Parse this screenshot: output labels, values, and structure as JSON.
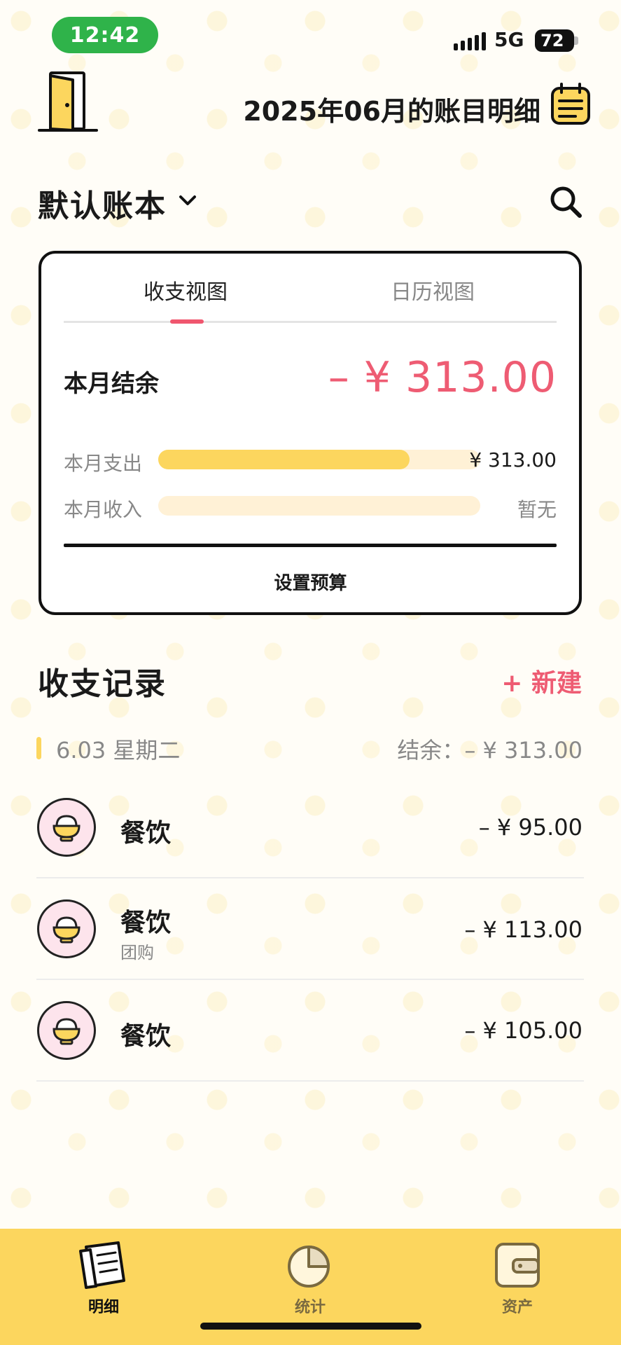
{
  "status_bar": {
    "time": "12:42",
    "network": "5G",
    "battery": "72"
  },
  "header": {
    "title": "2025年06月的账目明细"
  },
  "book_selector": {
    "label": "默认账本"
  },
  "summary_card": {
    "tabs": [
      {
        "label": "收支视图",
        "active": true
      },
      {
        "label": "日历视图",
        "active": false
      }
    ],
    "balance_label": "本月结余",
    "balance_amount": "– ¥ 313.00",
    "expense": {
      "label": "本月支出",
      "value": "¥ 313.00",
      "fill": 0.78
    },
    "income": {
      "label": "本月收入",
      "value": "暂无",
      "fill": 0
    },
    "budget_button": "设置预算"
  },
  "records": {
    "title": "收支记录",
    "new_button": "+ 新建",
    "days": [
      {
        "date": "6.03 星期二",
        "balance": "结余：– ¥ 313.00",
        "items": [
          {
            "category": "餐饮",
            "note": "",
            "amount": "– ¥ 95.00",
            "icon": "rice-bowl-icon"
          },
          {
            "category": "餐饮",
            "note": "团购",
            "amount": "– ¥ 113.00",
            "icon": "rice-bowl-icon"
          },
          {
            "category": "餐饮",
            "note": "",
            "amount": "– ¥ 105.00",
            "icon": "rice-bowl-icon"
          }
        ]
      }
    ]
  },
  "tab_bar": {
    "items": [
      {
        "label": "明细",
        "icon": "notes-icon",
        "active": true
      },
      {
        "label": "统计",
        "icon": "pie-chart-icon",
        "active": false
      },
      {
        "label": "资产",
        "icon": "wallet-icon",
        "active": false
      }
    ]
  },
  "colors": {
    "accent": "#ee5c73",
    "yellow": "#fcd65e",
    "pink_bg": "#fde4ec"
  }
}
